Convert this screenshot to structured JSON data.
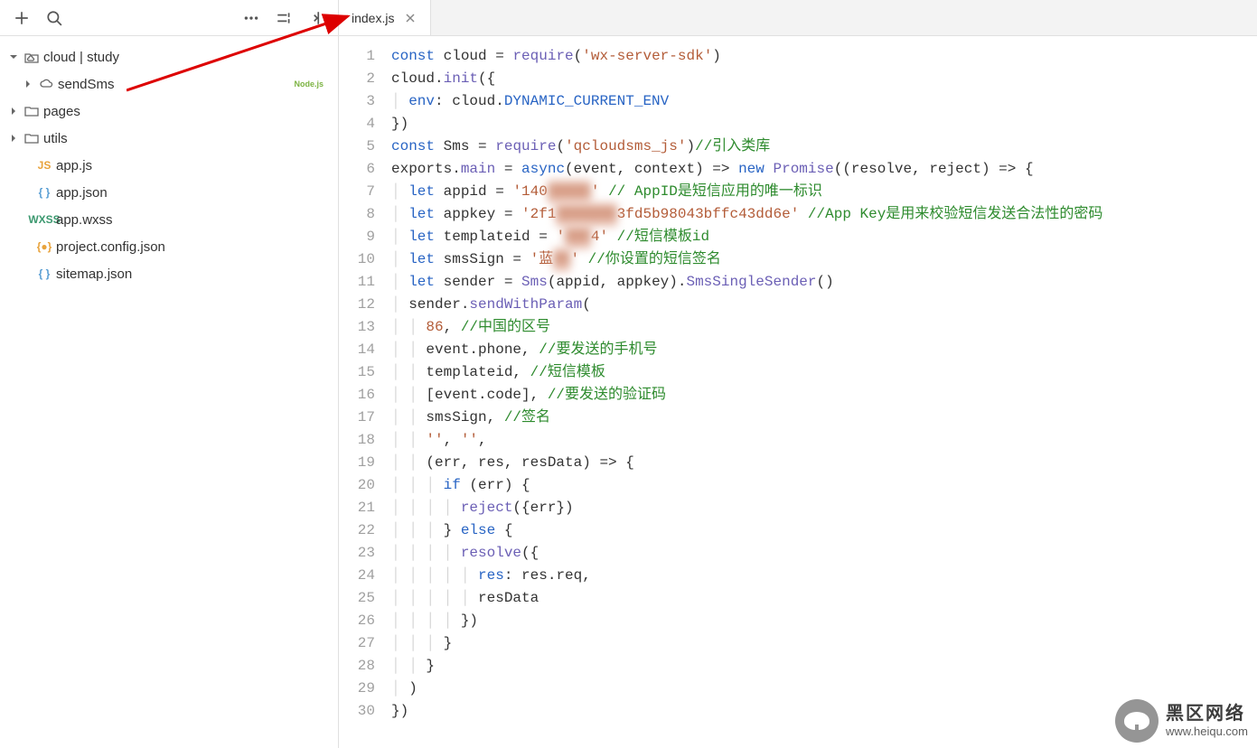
{
  "sidebar": {
    "root": {
      "label": "cloud | study"
    },
    "items": [
      {
        "label": "sendSms",
        "badge": "Node.js"
      },
      {
        "label": "pages"
      },
      {
        "label": "utils"
      },
      {
        "label": "app.js",
        "icon": "JS"
      },
      {
        "label": "app.json",
        "icon": "{ }"
      },
      {
        "label": "app.wxss",
        "icon": "WXSS"
      },
      {
        "label": "project.config.json",
        "icon": "{●}"
      },
      {
        "label": "sitemap.json",
        "icon": "{ }"
      }
    ]
  },
  "tab": {
    "title": "index.js"
  },
  "code": {
    "lines": [
      {
        "n": 1,
        "t": [
          {
            "c": "tok-kw",
            "s": "const"
          },
          {
            "s": " cloud = "
          },
          {
            "c": "tok-fn",
            "s": "require"
          },
          {
            "s": "("
          },
          {
            "c": "tok-str",
            "s": "'wx-server-sdk'"
          },
          {
            "s": ")"
          }
        ]
      },
      {
        "n": 2,
        "t": [
          {
            "s": "cloud."
          },
          {
            "c": "tok-fn",
            "s": "init"
          },
          {
            "s": "({"
          }
        ]
      },
      {
        "n": 3,
        "t": [
          {
            "c": "guide",
            "s": "│ "
          },
          {
            "c": "tok-prop",
            "s": "env"
          },
          {
            "s": ": cloud."
          },
          {
            "c": "tok-const",
            "s": "DYNAMIC_CURRENT_ENV"
          }
        ]
      },
      {
        "n": 4,
        "t": [
          {
            "s": "})"
          }
        ]
      },
      {
        "n": 5,
        "t": [
          {
            "c": "tok-kw",
            "s": "const"
          },
          {
            "s": " Sms = "
          },
          {
            "c": "tok-fn",
            "s": "require"
          },
          {
            "s": "("
          },
          {
            "c": "tok-str",
            "s": "'qcloudsms_js'"
          },
          {
            "s": ")"
          },
          {
            "c": "tok-cmt",
            "s": "//引入类库"
          }
        ]
      },
      {
        "n": 6,
        "t": [
          {
            "s": "exports."
          },
          {
            "c": "tok-fn",
            "s": "main"
          },
          {
            "s": " = "
          },
          {
            "c": "tok-kw",
            "s": "async"
          },
          {
            "s": "(event, context) => "
          },
          {
            "c": "tok-kw",
            "s": "new"
          },
          {
            "s": " "
          },
          {
            "c": "tok-fn",
            "s": "Promise"
          },
          {
            "s": "((resolve, reject) => {"
          }
        ]
      },
      {
        "n": 7,
        "t": [
          {
            "c": "guide",
            "s": "│ "
          },
          {
            "c": "tok-kw",
            "s": "let"
          },
          {
            "s": " appid = "
          },
          {
            "c": "tok-str",
            "s": "'140"
          },
          {
            "c": "tok-str blur",
            "s": "00000"
          },
          {
            "c": "tok-str",
            "s": "'"
          },
          {
            "s": " "
          },
          {
            "c": "tok-cmt",
            "s": "// AppID是短信应用的唯一标识"
          }
        ]
      },
      {
        "n": 8,
        "t": [
          {
            "c": "guide",
            "s": "│ "
          },
          {
            "c": "tok-kw",
            "s": "let"
          },
          {
            "s": " appkey = "
          },
          {
            "c": "tok-str",
            "s": "'2f1"
          },
          {
            "c": "tok-str blur",
            "s": "0000000"
          },
          {
            "c": "tok-str",
            "s": "3fd5b98043bffc43dd6e'"
          },
          {
            "s": " "
          },
          {
            "c": "tok-cmt",
            "s": "//App Key是用来校验短信发送合法性的密码"
          }
        ]
      },
      {
        "n": 9,
        "t": [
          {
            "c": "guide",
            "s": "│ "
          },
          {
            "c": "tok-kw",
            "s": "let"
          },
          {
            "s": " templateid = "
          },
          {
            "c": "tok-str",
            "s": "'"
          },
          {
            "c": "tok-str blur",
            "s": "000"
          },
          {
            "c": "tok-str",
            "s": "4'"
          },
          {
            "s": " "
          },
          {
            "c": "tok-cmt",
            "s": "//短信模板id"
          }
        ]
      },
      {
        "n": 10,
        "t": [
          {
            "c": "guide",
            "s": "│ "
          },
          {
            "c": "tok-kw",
            "s": "let"
          },
          {
            "s": " smsSign = "
          },
          {
            "c": "tok-str",
            "s": "'蓝"
          },
          {
            "c": "tok-str blur",
            "s": "00"
          },
          {
            "c": "tok-str",
            "s": "'"
          },
          {
            "s": " "
          },
          {
            "c": "tok-cmt",
            "s": "//你设置的短信签名"
          }
        ]
      },
      {
        "n": 11,
        "t": [
          {
            "c": "guide",
            "s": "│ "
          },
          {
            "c": "tok-kw",
            "s": "let"
          },
          {
            "s": " sender = "
          },
          {
            "c": "tok-fn",
            "s": "Sms"
          },
          {
            "s": "(appid, appkey)."
          },
          {
            "c": "tok-fn",
            "s": "SmsSingleSender"
          },
          {
            "s": "()"
          }
        ]
      },
      {
        "n": 12,
        "t": [
          {
            "c": "guide",
            "s": "│ "
          },
          {
            "s": "sender."
          },
          {
            "c": "tok-fn",
            "s": "sendWithParam"
          },
          {
            "s": "("
          }
        ]
      },
      {
        "n": 13,
        "t": [
          {
            "c": "guide",
            "s": "│ │ "
          },
          {
            "c": "tok-str",
            "s": "86"
          },
          {
            "s": ", "
          },
          {
            "c": "tok-cmt",
            "s": "//中国的区号"
          }
        ]
      },
      {
        "n": 14,
        "t": [
          {
            "c": "guide",
            "s": "│ │ "
          },
          {
            "s": "event.phone, "
          },
          {
            "c": "tok-cmt",
            "s": "//要发送的手机号"
          }
        ]
      },
      {
        "n": 15,
        "t": [
          {
            "c": "guide",
            "s": "│ │ "
          },
          {
            "s": "templateid, "
          },
          {
            "c": "tok-cmt",
            "s": "//短信模板"
          }
        ]
      },
      {
        "n": 16,
        "t": [
          {
            "c": "guide",
            "s": "│ │ "
          },
          {
            "s": "[event.code], "
          },
          {
            "c": "tok-cmt",
            "s": "//要发送的验证码"
          }
        ]
      },
      {
        "n": 17,
        "t": [
          {
            "c": "guide",
            "s": "│ │ "
          },
          {
            "s": "smsSign, "
          },
          {
            "c": "tok-cmt",
            "s": "//签名"
          }
        ]
      },
      {
        "n": 18,
        "t": [
          {
            "c": "guide",
            "s": "│ │ "
          },
          {
            "c": "tok-str",
            "s": "''"
          },
          {
            "s": ", "
          },
          {
            "c": "tok-str",
            "s": "''"
          },
          {
            "s": ","
          }
        ]
      },
      {
        "n": 19,
        "t": [
          {
            "c": "guide",
            "s": "│ │ "
          },
          {
            "s": "(err, res, resData) => {"
          }
        ]
      },
      {
        "n": 20,
        "t": [
          {
            "c": "guide",
            "s": "│ │ │ "
          },
          {
            "c": "tok-kw",
            "s": "if"
          },
          {
            "s": " (err) {"
          }
        ]
      },
      {
        "n": 21,
        "t": [
          {
            "c": "guide",
            "s": "│ │ │ │ "
          },
          {
            "c": "tok-fn",
            "s": "reject"
          },
          {
            "s": "({err})"
          }
        ]
      },
      {
        "n": 22,
        "t": [
          {
            "c": "guide",
            "s": "│ │ │ "
          },
          {
            "s": "} "
          },
          {
            "c": "tok-kw",
            "s": "else"
          },
          {
            "s": " {"
          }
        ]
      },
      {
        "n": 23,
        "t": [
          {
            "c": "guide",
            "s": "│ │ │ │ "
          },
          {
            "c": "tok-fn",
            "s": "resolve"
          },
          {
            "s": "({"
          }
        ]
      },
      {
        "n": 24,
        "t": [
          {
            "c": "guide",
            "s": "│ │ │ │ │ "
          },
          {
            "c": "tok-prop",
            "s": "res"
          },
          {
            "s": ": res.req,"
          }
        ]
      },
      {
        "n": 25,
        "t": [
          {
            "c": "guide",
            "s": "│ │ │ │ │ "
          },
          {
            "s": "resData"
          }
        ]
      },
      {
        "n": 26,
        "t": [
          {
            "c": "guide",
            "s": "│ │ │ │ "
          },
          {
            "s": "})"
          }
        ]
      },
      {
        "n": 27,
        "t": [
          {
            "c": "guide",
            "s": "│ │ │ "
          },
          {
            "s": "}"
          }
        ]
      },
      {
        "n": 28,
        "t": [
          {
            "c": "guide",
            "s": "│ │ "
          },
          {
            "s": "}"
          }
        ]
      },
      {
        "n": 29,
        "t": [
          {
            "c": "guide",
            "s": "│ "
          },
          {
            "s": ")"
          }
        ]
      },
      {
        "n": 30,
        "t": [
          {
            "s": "})"
          }
        ]
      }
    ]
  },
  "watermark": {
    "title": "黑区网络",
    "url": "www.heiqu.com"
  }
}
